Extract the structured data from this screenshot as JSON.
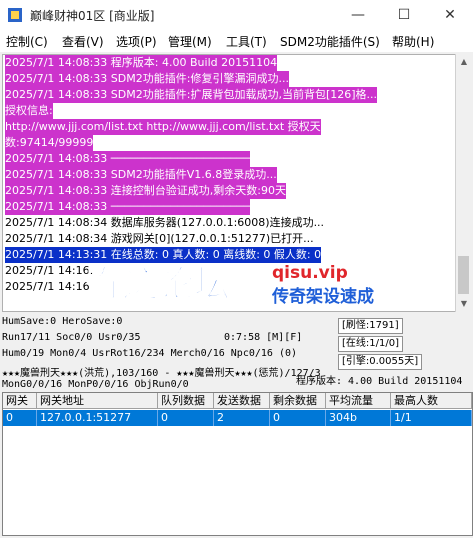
{
  "window": {
    "title": "巅峰财神01区 [商业版]",
    "minimize": "—",
    "maximize": "☐",
    "close": "✕"
  },
  "menu": [
    "控制(C)",
    "查看(V)",
    "选项(P)",
    "管理(M)",
    "工具(T)",
    "SDM2功能插件(S)",
    "帮助(H)"
  ],
  "log": [
    {
      "text": "2025/7/1 14:08:33 程序版本: 4.00 Build 20151104",
      "style": "magenta"
    },
    {
      "text": "2025/7/1 14:08:33 SDM2功能插件:修复引擎漏洞成功...",
      "style": "magenta"
    },
    {
      "text": "2025/7/1 14:08:33 SDM2功能插件:扩展背包加载成功,当前背包[126]格...",
      "style": "magenta"
    },
    {
      "text": "授权信息:",
      "style": "magenta"
    },
    {
      "text": "http://www.jjj.com/list.txt http://www.jjj.com/list.txt 授权天",
      "style": "magenta"
    },
    {
      "text": "数:97414/99999",
      "style": "magenta"
    },
    {
      "text": "2025/7/1 14:08:33 ─────────────────────",
      "style": "magenta"
    },
    {
      "text": "2025/7/1 14:08:33 SDM2功能插件V1.6.8登录成功...",
      "style": "magenta"
    },
    {
      "text": "2025/7/1 14:08:33 连接控制台验证成功,剩余天数:90天",
      "style": "magenta"
    },
    {
      "text": "2025/7/1 14:08:33 ─────────────────────",
      "style": "magenta"
    },
    {
      "text": "2025/7/1 14:08:34 数据库服务器(127.0.0.1:6008)连接成功...",
      "style": "plain"
    },
    {
      "text": "2025/7/1 14:08:34 游戏网关[0](127.0.0.1:51277)已打开...",
      "style": "plain"
    },
    {
      "text": "2025/7/1 14:13:31 在线总数: 0 真人数: 0 离线数: 0 假人数: 0",
      "style": "blue"
    },
    {
      "text": "2025/7/1 14:16:",
      "style": "plain"
    },
    {
      "text": "2025/7/1 14:16:",
      "style": "plain"
    }
  ],
  "watermark": {
    "main": "奇迹论坛",
    "domain": "qisu.vip",
    "slogan": "传奇架设速成"
  },
  "status": {
    "line1": "HumSave:0 HeroSave:0",
    "line2": "Run17/11 Soc0/0 Usr0/35",
    "time": "0:7:58 [M][F]",
    "line3": "Hum0/19 Mon0/4 UsrRot16/234 Merch0/16 Npc0/16 (0)",
    "line4": "★★★魔兽刑天★★★(洪荒),103/160 - ★★★魔兽刑天★★★(惩荒)/127/3",
    "line5": "MonG0/0/16 MonP0/0/16 ObjRun0/0",
    "refresh": "[刷怪:1791]",
    "online": "[在线:1/1/0]",
    "cite": "[引擎:0.0055天]",
    "version": "程序版本: 4.00 Build 20151104"
  },
  "grid": {
    "headers": [
      "网关",
      "网关地址",
      "队列数据",
      "发送数据",
      "剩余数据",
      "平均流量",
      "最高人数"
    ],
    "rows": [
      [
        "0",
        "127.0.0.1:51277",
        "0",
        "2",
        "0",
        "304b",
        "1/1"
      ]
    ]
  },
  "colors": {
    "magenta": "#cc33cc",
    "blue": "#0a30c8",
    "selection": "#0078d7"
  }
}
